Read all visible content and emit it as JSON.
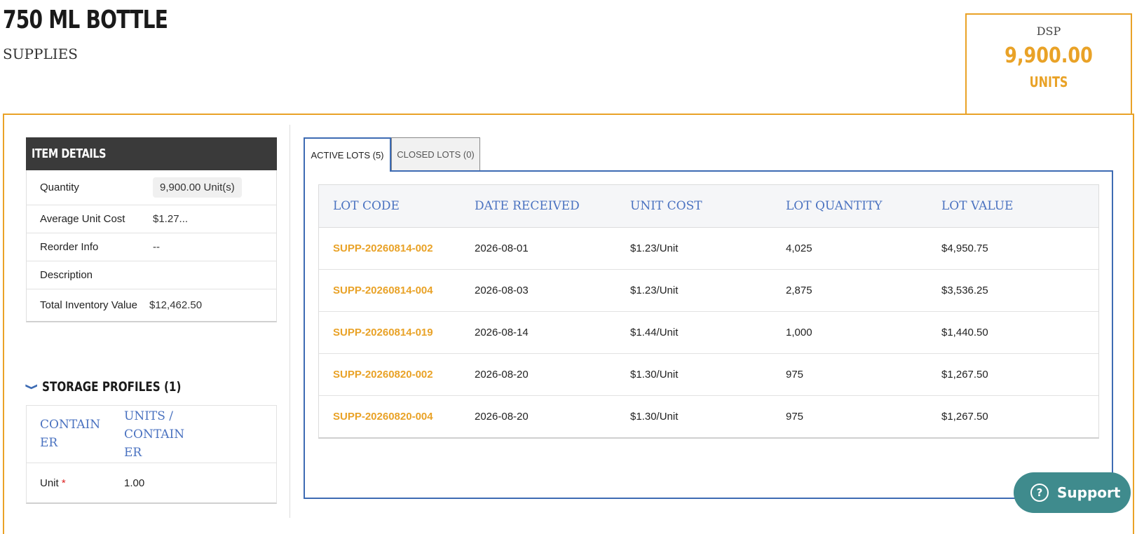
{
  "header": {
    "title": "750 ML BOTTLE",
    "subtitle": "SUPPLIES"
  },
  "dsp": {
    "label": "DSP",
    "value": "9,900.00",
    "unit": "UNITS"
  },
  "item_details": {
    "title": "ITEM DETAILS",
    "rows": [
      {
        "label": "Quantity",
        "value": "9,900.00 Unit(s)"
      },
      {
        "label": "Average Unit Cost",
        "value": "$1.27..."
      },
      {
        "label": "Reorder Info",
        "value": "--"
      },
      {
        "label": "Description",
        "value": ""
      },
      {
        "label": "Total Inventory Value",
        "value": "$12,462.50"
      }
    ]
  },
  "storage": {
    "title": "STORAGE PROFILES (1)",
    "headers": [
      "CONTAIN ER",
      "UNITS / CONTAIN ER"
    ],
    "row": {
      "container": "Unit",
      "required": "*",
      "units": "1.00"
    }
  },
  "tabs": [
    {
      "label": "ACTIVE LOTS (5)",
      "active": true
    },
    {
      "label": "CLOSED LOTS (0)",
      "active": false
    }
  ],
  "lots": {
    "headers": [
      "LOT CODE",
      "DATE RECEIVED",
      "UNIT COST",
      "LOT QUANTITY",
      "LOT VALUE"
    ],
    "rows": [
      [
        "SUPP-20260814-002",
        "2026-08-01",
        "$1.23/Unit",
        "4,025",
        "$4,950.75"
      ],
      [
        "SUPP-20260814-004",
        "2026-08-03",
        "$1.23/Unit",
        "2,875",
        "$3,536.25"
      ],
      [
        "SUPP-20260814-019",
        "2026-08-14",
        "$1.44/Unit",
        "1,000",
        "$1,440.50"
      ],
      [
        "SUPP-20260820-002",
        "2026-08-20",
        "$1.30/Unit",
        "975",
        "$1,267.50"
      ],
      [
        "SUPP-20260820-004",
        "2026-08-20",
        "$1.30/Unit",
        "975",
        "$1,267.50"
      ]
    ]
  },
  "support": {
    "label": "Support",
    "icon": "question-circle-icon"
  },
  "colors": {
    "accent": "#e9a227",
    "link_blue": "#4a72c0",
    "tab_border": "#3d6bb3",
    "support_bg": "#3f8b8d",
    "header_bg": "#3a3a3a"
  }
}
